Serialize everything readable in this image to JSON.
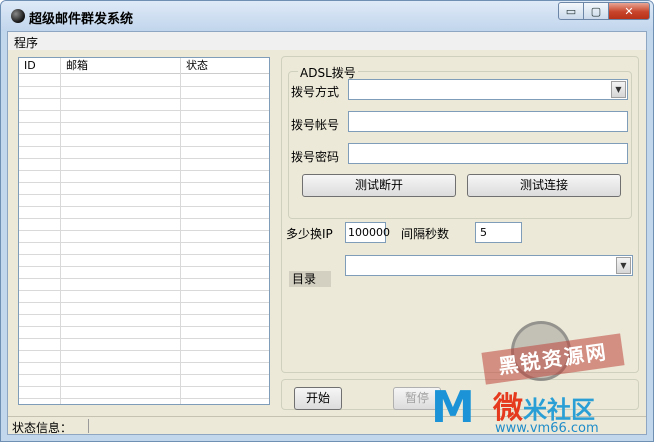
{
  "window": {
    "title": "超级邮件群发系统",
    "min_glyph": "▭",
    "max_glyph": "▢",
    "close_glyph": "✕"
  },
  "menu": {
    "items": [
      "程序"
    ]
  },
  "list": {
    "columns": [
      "ID",
      "邮箱",
      "状态"
    ]
  },
  "adsl": {
    "group_title": "ADSL拨号",
    "method_label": "拨号方式",
    "method_value": "",
    "account_label": "拨号帐号",
    "account_value": "",
    "password_label": "拨号密码",
    "password_value": "",
    "test_disconnect": "测试断开",
    "test_connect": "测试连接"
  },
  "settings": {
    "ip_label": "多少换IP",
    "ip_value": "100000",
    "interval_label": "间隔秒数",
    "interval_value": "5",
    "dir_label": "目录",
    "dir_value": ""
  },
  "actions": {
    "start": "开始",
    "pause": "暂停"
  },
  "status": {
    "label": "状态信息："
  },
  "watermark": {
    "banner": "黑锐资源网",
    "brand_char": "微",
    "brand_rest": "米社区",
    "url": "www.vm66.com",
    "logo": "M"
  },
  "icons": {
    "app": "app-icon",
    "combo": "chevron-down-icon"
  }
}
